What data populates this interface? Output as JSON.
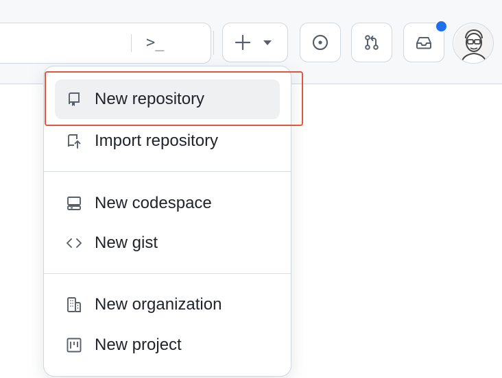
{
  "header": {
    "command_glyph": ">_",
    "create_button_label": "+",
    "icons": {
      "command_palette": "terminal-icon",
      "create": "plus-icon",
      "create_caret": "triangle-down-icon",
      "issues": "issue-opened-icon",
      "pull_requests": "git-pull-request-icon",
      "inbox": "inbox-icon",
      "avatar": "user-avatar"
    },
    "notification_color": "#1f6feb"
  },
  "create_menu": {
    "items": [
      {
        "label": "New repository",
        "icon": "repo-icon",
        "highlighted": true
      },
      {
        "label": "Import repository",
        "icon": "repo-push-icon"
      },
      {
        "label": "New codespace",
        "icon": "codespaces-icon"
      },
      {
        "label": "New gist",
        "icon": "code-icon"
      },
      {
        "label": "New organization",
        "icon": "organization-icon"
      },
      {
        "label": "New project",
        "icon": "project-icon"
      }
    ],
    "highlight_color": "#e5533d"
  }
}
